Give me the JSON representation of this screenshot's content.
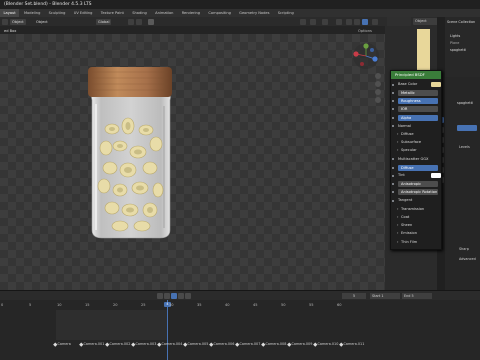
{
  "window": {
    "title": "(Blender Set.blend) - Blender 4.5.3 LTS"
  },
  "workspace_tabs": [
    "Layout",
    "Modeling",
    "Sculpting",
    "UV Editing",
    "Texture Paint",
    "Shading",
    "Animation",
    "Rendering",
    "Compositing",
    "Geometry Nodes",
    "Scripting"
  ],
  "active_tab": "Layout",
  "viewport_header": {
    "mode": "Object",
    "transform": "Global",
    "options": "Options",
    "left_label": "Object",
    "row2_label": "ed Box"
  },
  "shader_panel": {
    "title": "Principled BSDF",
    "rows": [
      "Base Color",
      "Metallic",
      "Roughness",
      "IOR",
      "Alpha",
      "Normal",
      "Diffuse",
      "Subsurface",
      "Specular",
      "Multiscatter GGX",
      "Diffuse",
      "Tint",
      "Anisotropic",
      "Anisotropic Rotation",
      "Tangent",
      "Transmission",
      "Coat",
      "Sheen",
      "Emission",
      "Thin Film"
    ],
    "field_labels": [
      "Metallic",
      "Roughness",
      "IOR",
      "Alpha",
      "Diffuse",
      "Anisotropic",
      "Anisotropic Rotation"
    ],
    "section_labels": [
      "Diffuse",
      "Subsurface",
      "Specular",
      "Transmission",
      "Coat",
      "Sheen",
      "Emission",
      "Thin Film"
    ],
    "plain_labels": [
      "Base Color",
      "Normal",
      "Multiscatter GGX",
      "Tint",
      "Tangent"
    ]
  },
  "outliner": {
    "header": "Object",
    "items": [
      "Scene Collection",
      "Lights",
      "Plane",
      "spaghetti"
    ]
  },
  "properties": {
    "object_name": "spaghetti",
    "labels": [
      "Levels",
      "Sharp",
      "Advanced"
    ]
  },
  "timeline": {
    "frame_current": "5",
    "start_label": "Start",
    "start_value": "1",
    "end_label": "End",
    "end_value": "5",
    "ticks": [
      "0",
      "5",
      "10",
      "15",
      "20",
      "25",
      "30",
      "35",
      "40",
      "45",
      "50",
      "55",
      "60"
    ],
    "playhead": "4",
    "markers": [
      "Camera",
      "Camera.001",
      "Camera.002",
      "Camera.003",
      "Camera.004",
      "Camera.005",
      "Camera.006",
      "Camera.007",
      "Camera.008",
      "Camera.009",
      "Camera.010",
      "Camera.011"
    ]
  },
  "colors": {
    "accent": "#4772b3",
    "shader_header": "#3a7d3a",
    "jar_lid": "#b7835a"
  }
}
